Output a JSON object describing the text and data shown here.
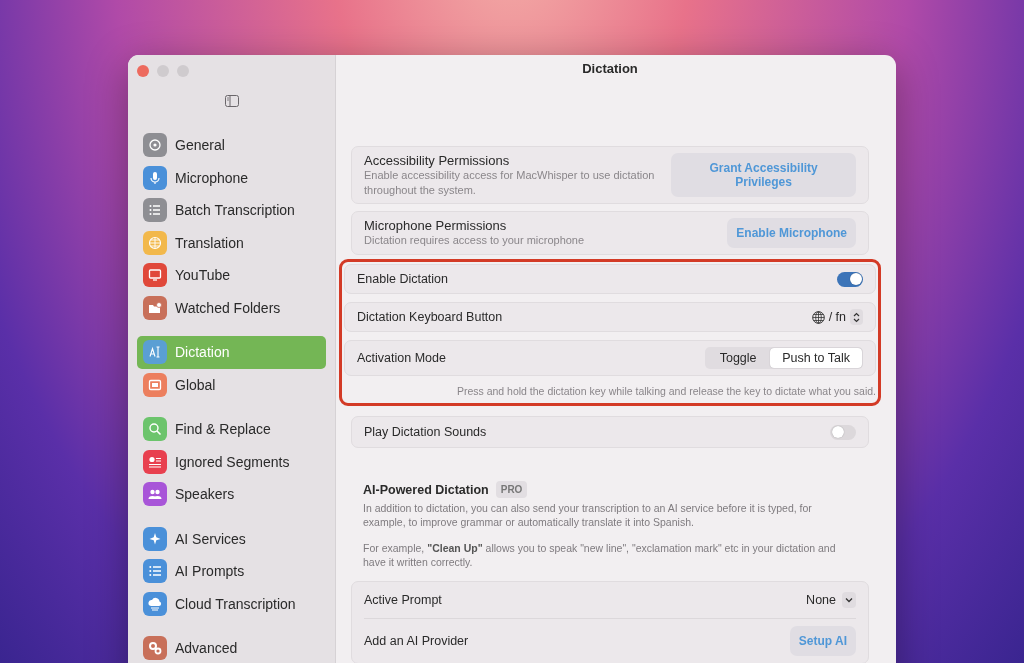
{
  "window": {
    "title": "Dictation"
  },
  "sidebar": {
    "groups": [
      [
        {
          "label": "General",
          "color": "#8e8e93",
          "selected": false
        },
        {
          "label": "Microphone",
          "color": "#4a90d9",
          "selected": false
        },
        {
          "label": "Batch Transcription",
          "color": "#8e8e93",
          "selected": false
        },
        {
          "label": "Translation",
          "color": "#f2b84b",
          "selected": false
        },
        {
          "label": "YouTube",
          "color": "#e0483a",
          "selected": false
        },
        {
          "label": "Watched Folders",
          "color": "#c8705a",
          "selected": false
        }
      ],
      [
        {
          "label": "Dictation",
          "color": "#5a9fd4",
          "selected": true
        },
        {
          "label": "Global",
          "color": "#ec7f5e",
          "selected": false
        }
      ],
      [
        {
          "label": "Find & Replace",
          "color": "#6cc46c",
          "selected": false
        },
        {
          "label": "Ignored Segments",
          "color": "#e8404f",
          "selected": false
        },
        {
          "label": "Speakers",
          "color": "#a855d8",
          "selected": false
        }
      ],
      [
        {
          "label": "AI Services",
          "color": "#4a90d9",
          "selected": false
        },
        {
          "label": "AI Prompts",
          "color": "#4a90d9",
          "selected": false
        },
        {
          "label": "Cloud Transcription",
          "color": "#4a90d9",
          "selected": false
        }
      ],
      [
        {
          "label": "Advanced",
          "color": "#c8705a",
          "selected": false
        }
      ]
    ]
  },
  "permissions": [
    {
      "title": "Accessibility Permissions",
      "description": "Enable accessibility access for MacWhisper to use dictation throughout the system.",
      "button": "Grant Accessibility Privileges"
    },
    {
      "title": "Microphone Permissions",
      "description": "Dictation requires access to your microphone",
      "button": "Enable Microphone"
    }
  ],
  "dictation": {
    "rows": [
      {
        "kind": "toggle",
        "label": "Enable Dictation",
        "on": true
      },
      {
        "kind": "picker",
        "label": "Dictation Keyboard Button",
        "value": "/ fn"
      },
      {
        "kind": "segmented",
        "label": "Activation Mode",
        "options": [
          {
            "label": "Toggle",
            "selected": false
          },
          {
            "label": "Push to Talk",
            "selected": true
          }
        ]
      }
    ],
    "hint": "Press and hold the dictation key while talking and release the key to dictate what you said."
  },
  "sounds": {
    "label": "Play Dictation Sounds",
    "on": false
  },
  "ai": {
    "title": "AI-Powered Dictation",
    "badge": "PRO",
    "paragraphs": [
      "In addition to dictation, you can also send your transcription to an AI service before it is typed, for example, to improve grammar or automatically translate it into Spanish.",
      "For example, **\"Clean Up\"** allows you to speak \"new line\", \"exclamation mark\" etc in your dictation and have it written correctly."
    ],
    "rows": [
      {
        "kind": "dropdown",
        "label": "Active Prompt",
        "value": "None"
      },
      {
        "kind": "action",
        "label": "Add an AI Provider",
        "button": "Setup AI"
      }
    ]
  }
}
